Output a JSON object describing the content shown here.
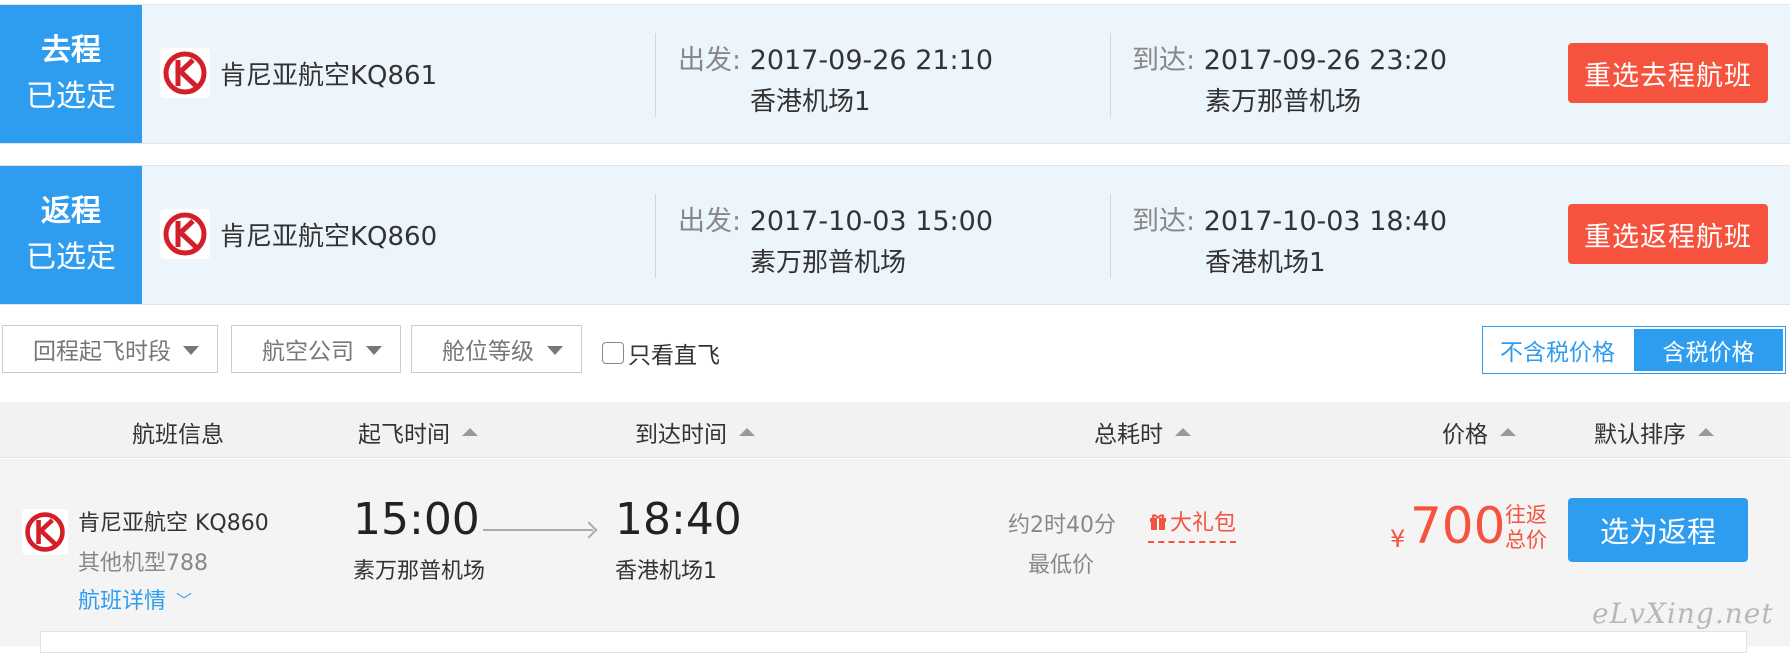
{
  "outbound": {
    "tag_line1": "去程",
    "tag_line2": "已选定",
    "airline_flight": "肯尼亚航空KQ861",
    "depart_label": "出发:",
    "depart_time": "2017-09-26 21:10",
    "depart_airport": "香港机场1",
    "arrive_label": "到达:",
    "arrive_time": "2017-09-26 23:20",
    "arrive_airport": "素万那普机场",
    "reselect_label": "重选去程航班"
  },
  "return": {
    "tag_line1": "返程",
    "tag_line2": "已选定",
    "airline_flight": "肯尼亚航空KQ860",
    "depart_label": "出发:",
    "depart_time": "2017-10-03 15:00",
    "depart_airport": "素万那普机场",
    "arrive_label": "到达:",
    "arrive_time": "2017-10-03 18:40",
    "arrive_airport": "香港机场1",
    "reselect_label": "重选返程航班"
  },
  "filters": {
    "time_slot": "回程起飞时段",
    "airline": "航空公司",
    "cabin": "舱位等级",
    "direct_only": "只看直飞"
  },
  "price_toggle": {
    "excl_tax": "不含税价格",
    "incl_tax": "含税价格",
    "active": "incl_tax"
  },
  "table_headers": {
    "flight_info": "航班信息",
    "depart_time": "起飞时间",
    "arrive_time": "到达时间",
    "duration": "总耗时",
    "price": "价格",
    "default_sort": "默认排序"
  },
  "result": {
    "airline_flight": "肯尼亚航空 KQ860",
    "aircraft": "其他机型788",
    "details_link": "航班详情",
    "depart_time": "15:00",
    "depart_airport": "素万那普机场",
    "arrive_time": "18:40",
    "arrive_airport": "香港机场1",
    "duration": "约2时40分",
    "lowest_note": "最低价",
    "gift_label": "大礼包",
    "currency": "¥",
    "price": "700",
    "price_note_line1": "往返",
    "price_note_line2": "总价",
    "choose_label": "选为返程"
  },
  "watermark": "eLvXing.net",
  "colors": {
    "primary_blue": "#2e9df0",
    "accent_red": "#f5533d",
    "selected_bg": "#edf5fc"
  }
}
